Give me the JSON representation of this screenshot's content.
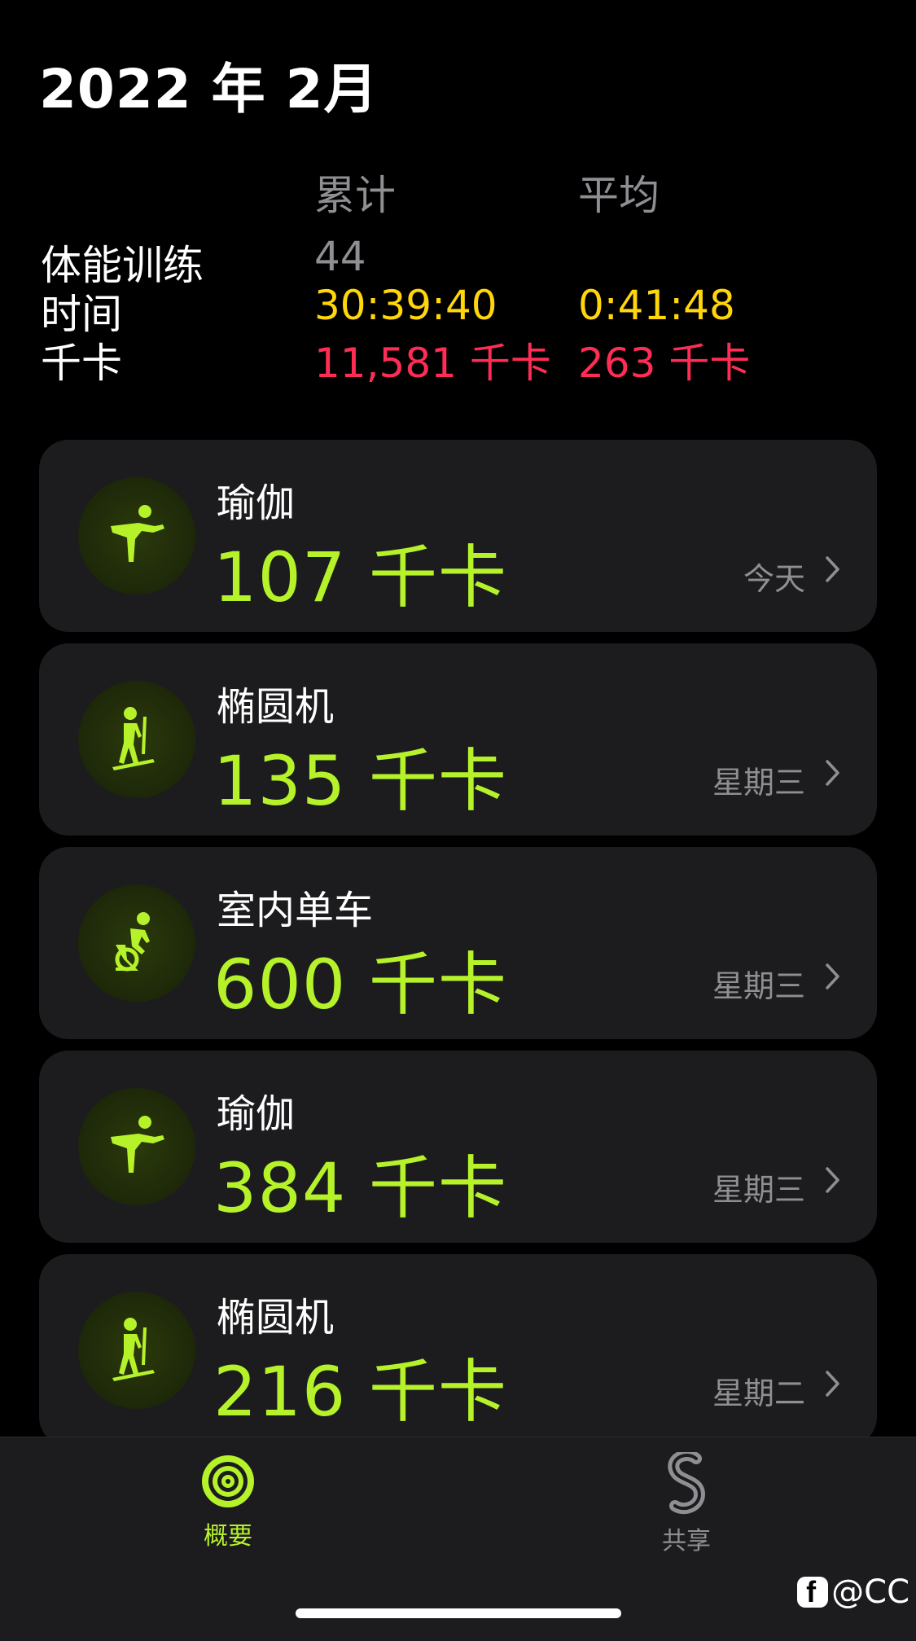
{
  "header": {
    "title": "2022 年 2月"
  },
  "summary": {
    "col_total": "累计",
    "col_avg": "平均",
    "rows": [
      {
        "label": "体能训练",
        "total": "44",
        "avg": ""
      },
      {
        "label": "时间",
        "total": "30:39:40",
        "avg": "0:41:48"
      },
      {
        "label": "千卡",
        "total": "11,581 千卡",
        "avg": "263 千卡"
      }
    ]
  },
  "workouts": [
    {
      "name": "瑜伽",
      "kcal": "107 千卡",
      "date": "今天",
      "icon": "yoga-icon"
    },
    {
      "name": "椭圆机",
      "kcal": "135 千卡",
      "date": "星期三",
      "icon": "elliptical-icon"
    },
    {
      "name": "室内单车",
      "kcal": "600 千卡",
      "date": "星期三",
      "icon": "indoor-cycle-icon"
    },
    {
      "name": "瑜伽",
      "kcal": "384 千卡",
      "date": "星期三",
      "icon": "yoga-icon"
    },
    {
      "name": "椭圆机",
      "kcal": "216 千卡",
      "date": "星期二",
      "icon": "elliptical-icon"
    }
  ],
  "tabbar": {
    "summary_label": "概要",
    "sharing_label": "共享"
  },
  "watermark": {
    "text": "@CC"
  },
  "colors": {
    "accent_green": "#b6f22a",
    "yellow": "#ffd60a",
    "red": "#ff2d55",
    "card_bg": "#1c1c1e"
  }
}
